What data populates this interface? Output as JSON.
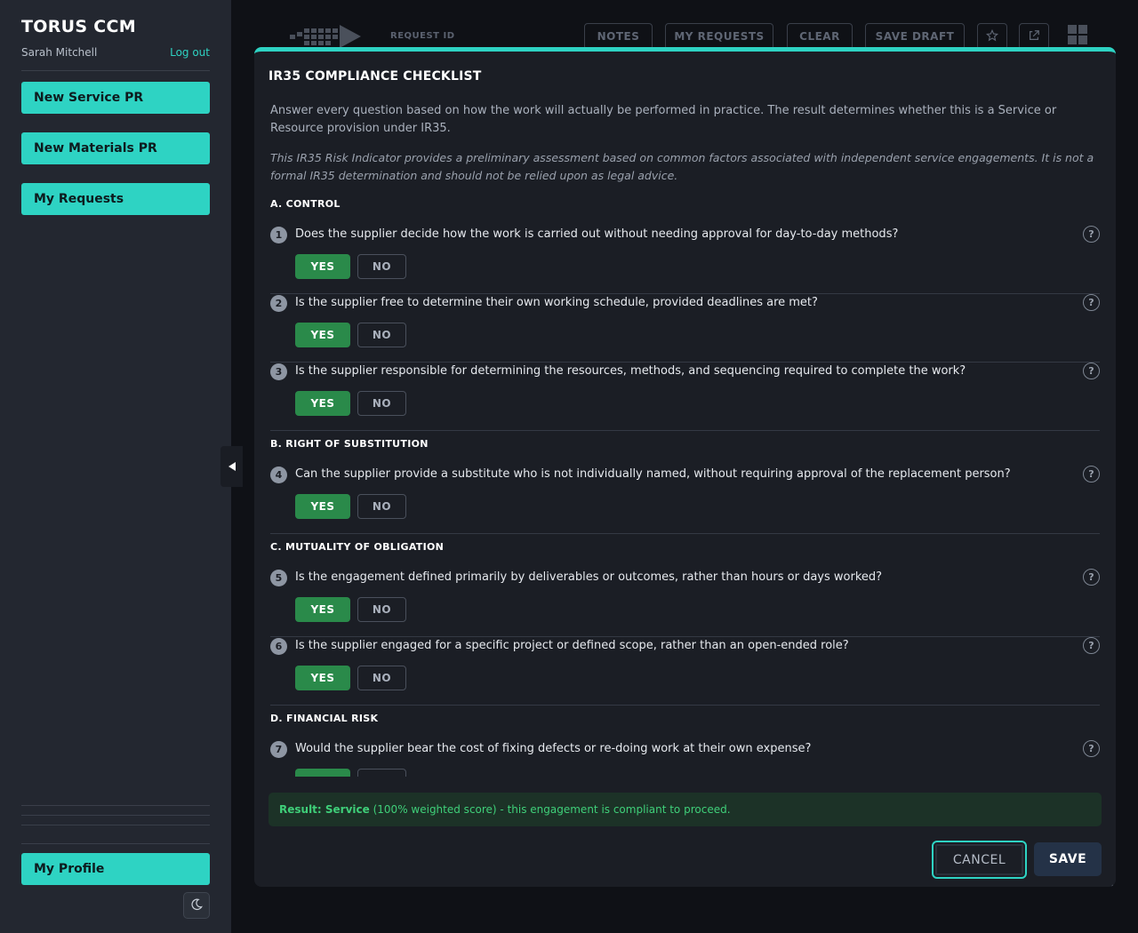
{
  "sidebar": {
    "brand": "TORUS CCM",
    "user_name": "Sarah Mitchell",
    "logout": "Log out",
    "nav": [
      {
        "label": "New Service PR"
      },
      {
        "label": "New Materials PR"
      },
      {
        "label": "My Requests"
      }
    ],
    "profile": "My Profile",
    "theme_icon": "moon-icon",
    "collapse_icon": "triangle-left-icon"
  },
  "topbar": {
    "request_id_label": "REQUEST ID",
    "buttons": [
      "NOTES",
      "MY REQUESTS",
      "CLEAR",
      "SAVE DRAFT"
    ],
    "icons": [
      "star-icon",
      "external-link-icon",
      "grid-icon"
    ]
  },
  "modal": {
    "title": "IR35 COMPLIANCE CHECKLIST",
    "intro": "Answer every question based on how the work will actually be performed in practice. The result determines whether this is a Service or Resource provision under IR35.",
    "disclaimer": "This IR35 Risk Indicator provides a preliminary assessment based on common factors associated with independent service engagements. It is not a formal IR35 determination and should not be relied upon as legal advice.",
    "sections": [
      {
        "title": "A. CONTROL"
      },
      {
        "title": "B. RIGHT OF SUBSTITUTION"
      },
      {
        "title": "C. MUTUALITY OF OBLIGATION"
      },
      {
        "title": "D. FINANCIAL RISK"
      }
    ],
    "yes_label": "YES",
    "no_label": "NO",
    "help_label": "?",
    "questions": [
      {
        "num": "1",
        "text": "Does the supplier decide how the work is carried out without needing approval for day-to-day methods?",
        "answer": "YES"
      },
      {
        "num": "2",
        "text": "Is the supplier free to determine their own working schedule, provided deadlines are met?",
        "answer": "YES"
      },
      {
        "num": "3",
        "text": "Is the supplier responsible for determining the resources, methods, and sequencing required to complete the work?",
        "answer": "YES"
      },
      {
        "num": "4",
        "text": "Can the supplier provide a substitute who is not individually named, without requiring approval of the replacement person?",
        "answer": "YES"
      },
      {
        "num": "5",
        "text": "Is the engagement defined primarily by deliverables or outcomes, rather than hours or days worked?",
        "answer": "YES"
      },
      {
        "num": "6",
        "text": "Is the supplier engaged for a specific project or defined scope, rather than an open-ended role?",
        "answer": "YES"
      },
      {
        "num": "7",
        "text": "Would the supplier bear the cost of fixing defects or re-doing work at their own expense?",
        "answer": "YES"
      }
    ],
    "result": {
      "label": "Result: Service",
      "detail": "(100% weighted score) - this engagement is compliant to proceed."
    },
    "cancel": "CANCEL",
    "save": "SAVE"
  },
  "colors": {
    "accent": "#2ed3c3",
    "yes_active": "#2a8a4a",
    "result_text": "#3fcf79",
    "save_bg": "#243247"
  }
}
